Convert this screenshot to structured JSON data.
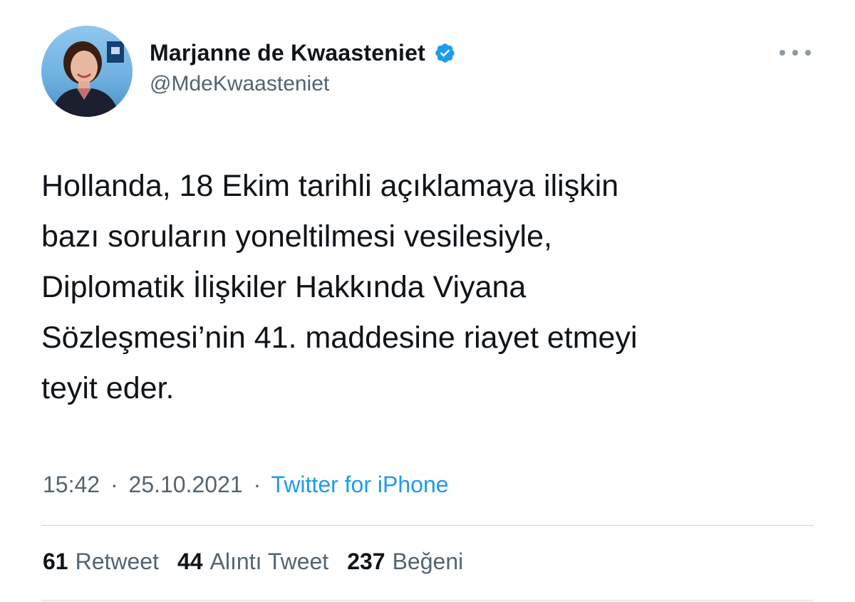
{
  "author": {
    "display_name": "Marjanne de Kwaasteniet",
    "handle": "@MdeKwaasteniet",
    "verified": true
  },
  "tweet": {
    "text": "Hollanda, 18 Ekim tarihli açıklamaya ilişkin\nbazı soruların yoneltilmesi vesilesiyle,\nDiplomatik İlişkiler Hakkında Viyana\nSözleşmesi’nin 41. maddesine riayet etmeyi\nteyit eder.",
    "time": "15:42",
    "date": "25.10.2021",
    "separator": "·",
    "source": "Twitter for iPhone"
  },
  "stats": {
    "retweets": {
      "count": "61",
      "label": "Retweet"
    },
    "quotes": {
      "count": "44",
      "label": "Alıntı Tweet"
    },
    "likes": {
      "count": "237",
      "label": "Beğeni"
    }
  },
  "icons": {
    "verified": "verified-badge-icon",
    "more": "more-options-icon"
  },
  "colors": {
    "link": "#1d9bf0",
    "verified": "#1d9bf0",
    "secondary_text": "#536471",
    "primary_text": "#0f1419"
  }
}
